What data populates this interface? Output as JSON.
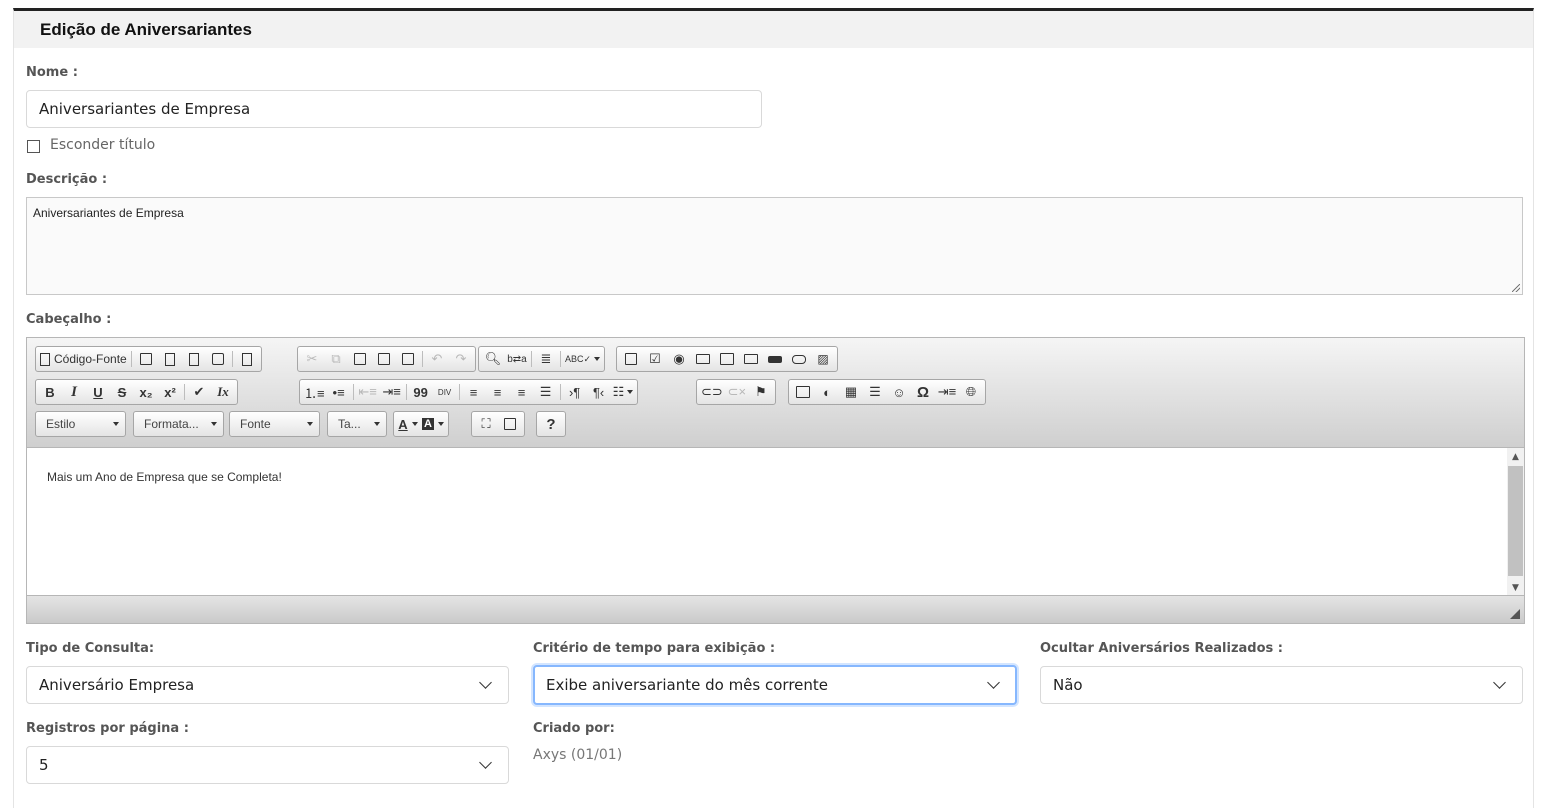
{
  "panel": {
    "title": "Edição de Aniversariantes"
  },
  "form": {
    "nome_label": "Nome :",
    "nome_value": "Aniversariantes de Empresa",
    "esconder_label": "Esconder título",
    "descricao_label": "Descrição :",
    "descricao_value": "Aniversariantes de Empresa",
    "cabecalho_label": "Cabeçalho :",
    "tipo_label": "Tipo de Consulta:",
    "tipo_value": "Aniversário Empresa",
    "criterio_label": "Critério de tempo para exibição :",
    "criterio_value": "Exibe aniversariante do mês corrente",
    "ocultar_label": "Ocultar Aniversários Realizados :",
    "ocultar_value": "Não",
    "registros_label": "Registros por página :",
    "registros_value": "5",
    "criado_label": "Criado por:",
    "criado_value": "Axys (01/01)"
  },
  "editor": {
    "source_label": "Código-Fonte",
    "content": "Mais um Ano de Empresa que se Completa!",
    "combos": {
      "estilo": "Estilo",
      "formatacao": "Formata...",
      "fonte": "Fonte",
      "tamanho": "Ta..."
    },
    "buttons": {
      "bold": "B",
      "italic": "I",
      "underline": "U",
      "strike": "S",
      "subscript": "x₂",
      "superscript": "x²",
      "remove_format": "Ix",
      "blockquote": "99",
      "special_char": "Ω",
      "help": "?"
    }
  }
}
